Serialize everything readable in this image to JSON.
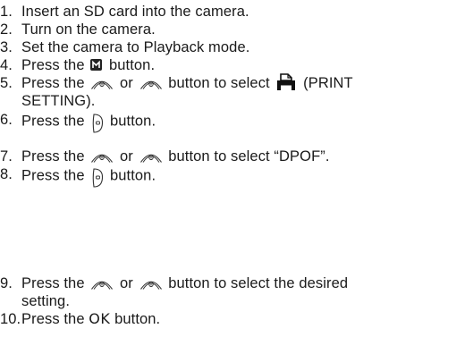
{
  "steps": [
    {
      "num": "1.",
      "text": "Insert an SD card into the camera."
    },
    {
      "num": "2.",
      "text": "Turn on the camera."
    },
    {
      "num": "3.",
      "text": "Set the camera to Playback mode."
    },
    {
      "num": "4.",
      "pre": "Press the",
      "post": "button."
    },
    {
      "num": "5.",
      "pre": "Press the",
      "mid": "or",
      "post": "button to select",
      "tail": "(PRINT",
      "line2": "SETTING)."
    },
    {
      "num": "6.",
      "pre": "Press the",
      "post": "button."
    },
    {
      "num": "7.",
      "pre": "Press the",
      "mid": "or",
      "post": "button to select “DPOF”."
    },
    {
      "num": "8.",
      "pre": "Press the",
      "post": "button."
    },
    {
      "num": "9.",
      "pre": "Press the",
      "mid": "or",
      "post": "button to select the desired",
      "line2": "setting."
    },
    {
      "num": "10.",
      "pre": "Press the",
      "ok": "OK",
      "post": "button."
    }
  ],
  "icons": {
    "menu": "menu-button-icon",
    "up": "up-button-icon",
    "down": "down-button-icon",
    "print": "print-setting-icon",
    "shutter": "shutter-button-icon"
  }
}
